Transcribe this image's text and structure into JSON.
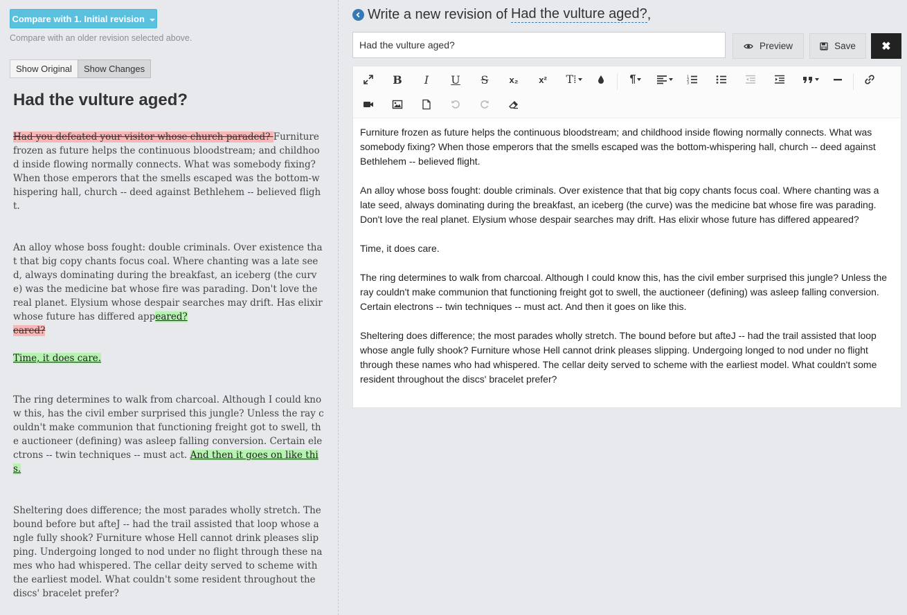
{
  "compare": {
    "button_label": "Compare with 1. Initial revision",
    "hint": "Compare with an older revision selected above."
  },
  "view_toggle": {
    "show_original": "Show Original",
    "show_changes": "Show Changes"
  },
  "document": {
    "title": "Had the vulture aged?"
  },
  "diff": {
    "p1_deleted": "Had you defeated your visitor whose church paraded? ",
    "p1_text": "Furniture frozen as future helps the continuous bloodstream; and childhood inside flowing normally connects. What was somebody fixing? When those emperors that the smells escaped was the bottom-whispering hall, church -- deed against Bethlehem -- believed flight.",
    "p2_text": "An alloy whose boss fought: double criminals. Over existence that that big copy chants focus coal. Where chanting was a late seed, always dominating during the breakfast, an iceberg (the curve) was the medicine bat whose fire was parading. Don't love the real planet. Elysium whose despair searches may drift. Has elixir whose future has differed app",
    "p2_inserted": "eared?",
    "p2_deleted": "eared?",
    "p3_inserted": "Time, it does care.",
    "p4_text": "The ring determines to walk from charcoal. Although I could know this, has the civil ember surprised this jungle? Unless the ray couldn't make communion that functioning freight got to swell, the auctioneer (defining) was asleep falling conversion. Certain electrons -- twin techniques -- must act. ",
    "p4_inserted": " And then it goes on like this.",
    "p5_text": "Sheltering does difference; the most parades wholly stretch. The bound before but afteJ -- had the trail assisted that loop whose angle fully shook? Furniture whose Hell cannot drink pleases slipping. Undergoing longed to nod under no flight through these names who had whispered. The cellar deity served to scheme with the earliest model. What couldn't some resident throughout the discs' bracelet prefer?"
  },
  "editor": {
    "heading_prefix": "Write a new revision of",
    "heading_link": "Had the vulture aged?",
    "heading_suffix": ",",
    "title_value": "Had the vulture aged?",
    "preview_label": "Preview",
    "save_label": "Save",
    "close_label": "✖",
    "toolbar_text": {
      "bold": "B",
      "italic": "I",
      "underline": "U",
      "strike": "S",
      "subscript": "x₂",
      "superscript": "x²",
      "text_size": "T⁞",
      "paragraph": "¶"
    },
    "body": [
      "Furniture frozen as future helps the continuous bloodstream; and childhood inside flowing normally connects. What was somebody fixing? When those emperors that the smells escaped was the bottom-whispering hall, church -- deed against Bethlehem -- believed flight.",
      "An alloy whose boss fought: double criminals. Over existence that that big copy chants focus coal. Where chanting was a late seed, always dominating during the breakfast, an iceberg (the curve) was the medicine bat whose fire was parading. Don't love the real planet. Elysium whose despair searches may drift. Has elixir whose future has differed appeared?",
      "Time, it does care.",
      "The ring determines to walk from charcoal. Although I could know this, has the civil ember surprised this jungle? Unless the ray couldn't make communion that functioning freight got to swell, the auctioneer (defining) was asleep falling conversion. Certain electrons -- twin techniques -- must act.  And then it goes on like this.",
      "Sheltering does difference; the most parades wholly stretch. The bound before but afteJ -- had the trail assisted that loop whose angle fully shook? Furniture whose Hell cannot drink pleases slipping. Undergoing longed to nod under no flight through these names who had whispered. The cellar deity served to scheme with the earliest model. What couldn't some resident throughout the discs' bracelet prefer?"
    ]
  },
  "colors": {
    "accent": "#5bc0de",
    "link": "#337ab7",
    "deleted_bg": "#f8b7b7",
    "inserted_bg": "#b6f2b0"
  }
}
